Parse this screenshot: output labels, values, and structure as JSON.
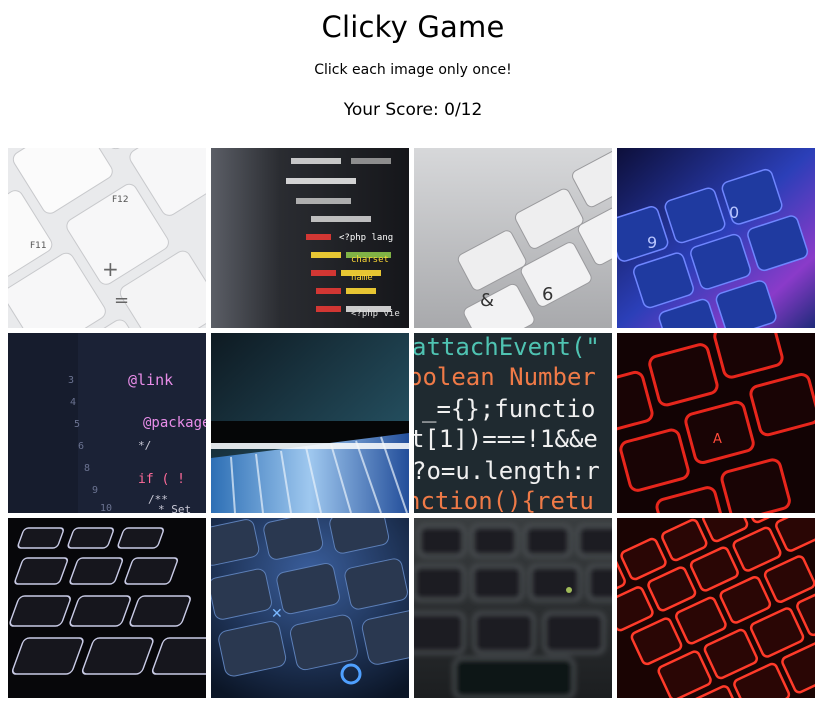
{
  "header": {
    "title": "Clicky Game",
    "instructions": "Click each image only once!",
    "score_label": "Your Score: 0/12"
  },
  "tiles": [
    {
      "id": 1,
      "icon": "white-keyboard-f11-f12-icon"
    },
    {
      "id": 2,
      "icon": "code-on-laptop-screen-icon"
    },
    {
      "id": 3,
      "icon": "gray-keyboard-closeup-icon"
    },
    {
      "id": 4,
      "icon": "blue-purple-lit-keyboard-icon"
    },
    {
      "id": 5,
      "icon": "css-code-editor-icon"
    },
    {
      "id": 6,
      "icon": "laptop-screen-wave-icon"
    },
    {
      "id": 7,
      "icon": "javascript-code-closeup-icon"
    },
    {
      "id": 8,
      "icon": "red-backlit-keyboard-icon"
    },
    {
      "id": 9,
      "icon": "dark-keyboard-keys-icon"
    },
    {
      "id": 10,
      "icon": "blue-backlit-keyboard-icon"
    },
    {
      "id": 11,
      "icon": "blurred-keyboard-icon"
    },
    {
      "id": 12,
      "icon": "red-lit-keyboard-icon"
    }
  ],
  "tile_code_text": {
    "tile5": [
      "@link",
      "@package",
      "*/",
      "if ( !",
      "/**",
      "* Set"
    ],
    "tile7": [
      "attachEvent(\"",
      "oolean Number",
      "_={};functio",
      "t[1])===!1&&e",
      "?o=u.length:r",
      "nction(){retu"
    ],
    "tile1": [
      "F11",
      "F12",
      "+",
      "="
    ],
    "tile3": [
      "&",
      "6"
    ],
    "tile4": [
      "9",
      "0"
    ],
    "tile8": [
      "A"
    ],
    "tile2": [
      "<?php lang",
      "charset",
      "name",
      "<?php vie"
    ]
  }
}
